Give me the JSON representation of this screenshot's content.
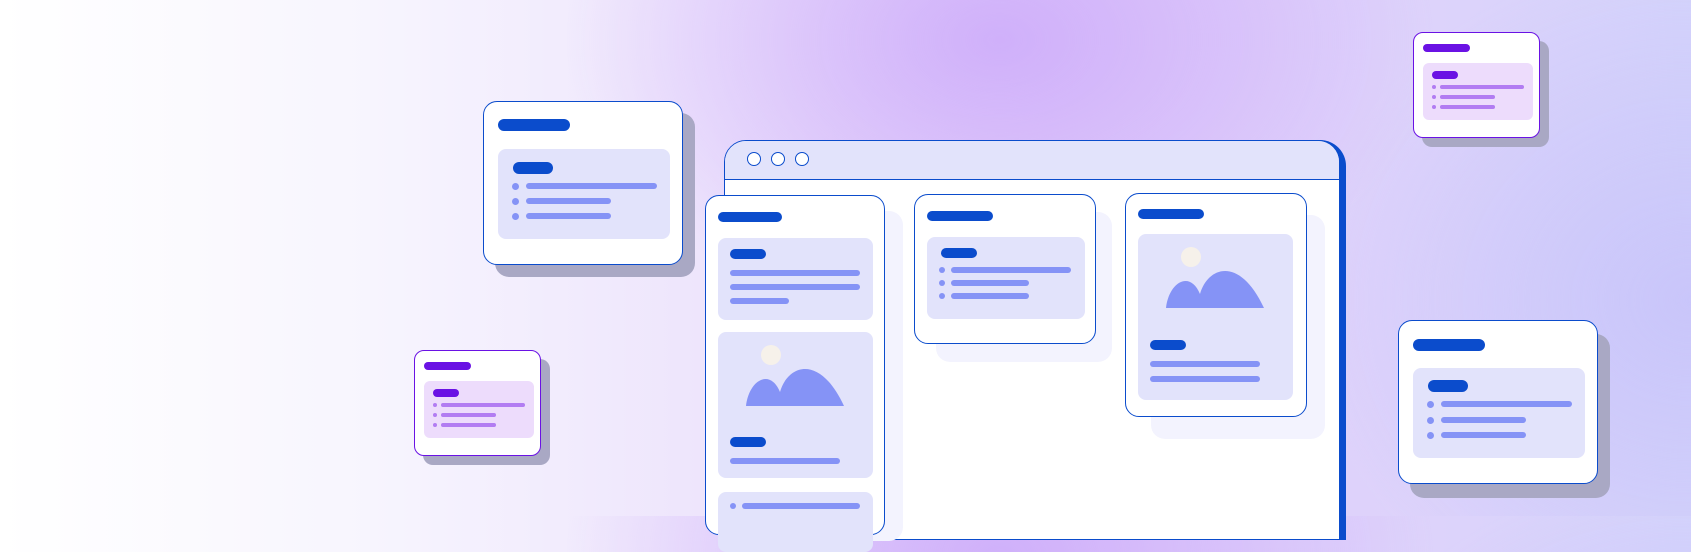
{
  "scene": {
    "description_free": true
  },
  "colors": {
    "accent_blue": "#0b4ccc",
    "accent_purple": "#6a12e4",
    "line_blue": "#8593f6",
    "line_purple": "#b27cf2",
    "panel_blue": "#e2e3fb",
    "panel_purple": "#eddcfc",
    "shadow_gray": "#a8a6c6"
  },
  "browser": {
    "window_buttons": [
      "close",
      "minimize",
      "maximize"
    ]
  },
  "icons": {
    "image_placeholder": "image-icon"
  }
}
